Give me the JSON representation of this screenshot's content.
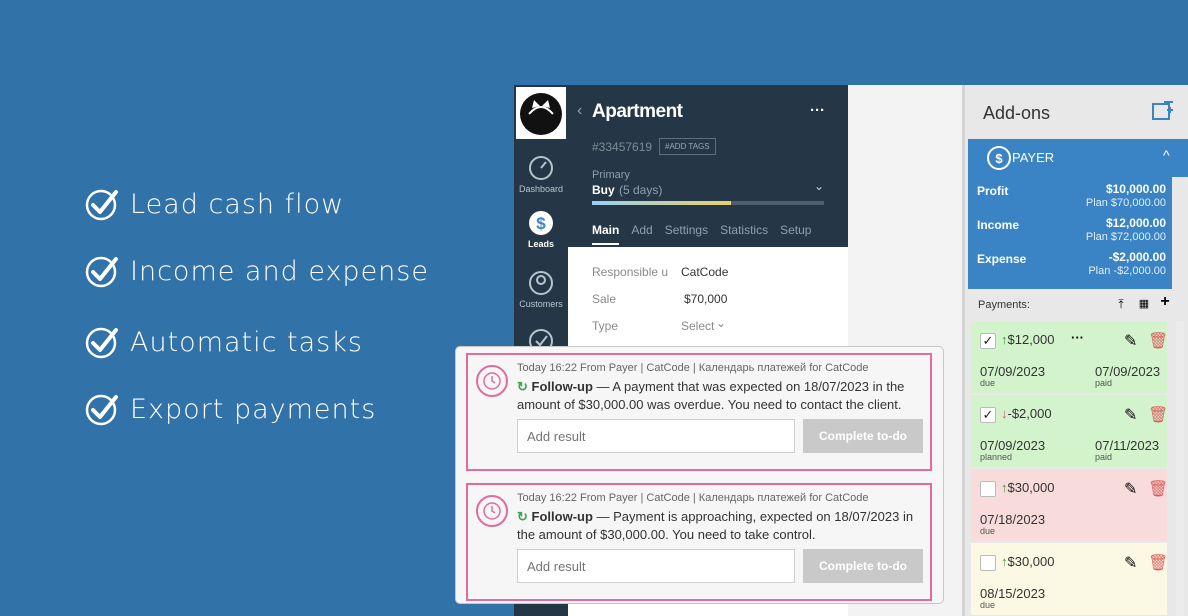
{
  "features": [
    {
      "label": "Lead cash flow"
    },
    {
      "label": "Income and expense"
    },
    {
      "label": "Automatic tasks"
    },
    {
      "label": "Export payments"
    }
  ],
  "nav": [
    {
      "label": "Dashboard",
      "icon": "dashboard-icon"
    },
    {
      "label": "Leads",
      "icon": "leads-icon"
    },
    {
      "label": "Customers",
      "icon": "customers-icon"
    },
    {
      "label": "",
      "icon": "tasks-icon"
    }
  ],
  "lead": {
    "title": "Apartment",
    "more": "···",
    "id": "#33457619",
    "add_tags": "#ADD TAGS",
    "pipeline": "Primary",
    "stage": "Buy",
    "stage_days": "(5 days)",
    "stage_progress": 0.6,
    "tabs": [
      "Main",
      "Add",
      "Settings",
      "Statistics",
      "Setup"
    ],
    "fields": [
      {
        "label": "Responsible u",
        "value": "CatCode"
      },
      {
        "label": "Sale",
        "value": "$70,000"
      },
      {
        "label": "Type",
        "value": "Select"
      }
    ]
  },
  "addons": {
    "title": "Add-ons",
    "payer_label": "PAYER",
    "summary": [
      {
        "key": "Profit",
        "value": "$10,000.00",
        "plan": "Plan $70,000.00"
      },
      {
        "key": "Income",
        "value": "$12,000.00",
        "plan": "Plan $72,000.00"
      },
      {
        "key": "Expense",
        "value": "-$2,000.00",
        "plan": "Plan -$2,000.00"
      }
    ],
    "payments_label": "Payments:",
    "payments": [
      {
        "checked": "✓",
        "amount": "$12,000",
        "dir": "up",
        "dots": "···",
        "date1": "07/09/2023",
        "s1": "due",
        "date2": "07/09/2023",
        "s2": "paid",
        "bg": "#d3f3cd"
      },
      {
        "checked": "✓",
        "amount": "-$2,000",
        "dir": "down",
        "dots": "",
        "date1": "07/09/2023",
        "s1": "planned",
        "date2": "07/11/2023",
        "s2": "paid",
        "bg": "#d3f3cd"
      },
      {
        "checked": "",
        "amount": "$30,000",
        "dir": "up",
        "dots": "",
        "date1": "07/18/2023",
        "s1": "due",
        "date2": "",
        "s2": "",
        "bg": "#f8dcdc"
      },
      {
        "checked": "",
        "amount": "$30,000",
        "dir": "up",
        "dots": "",
        "date1": "08/15/2023",
        "s1": "due",
        "date2": "",
        "s2": "",
        "bg": "#fbf9e4"
      }
    ]
  },
  "notes": [
    {
      "meta": "Today 16:22 From Payer | CatCode | Календарь платежей for CatCode",
      "kind": "Follow-up",
      "text": " — A payment that was expected on 18/07/2023 in the amount of $30,000.00 was overdue. You need to contact the client.",
      "placeholder": "Add result",
      "button": "Complete to-do"
    },
    {
      "meta": "Today 16:22 From Payer | CatCode | Календарь платежей for CatCode",
      "kind": "Follow-up",
      "text": " — Payment is approaching, expected on 18/07/2023 in the amount of $30,000.00. You need to take control.",
      "placeholder": "Add result",
      "button": "Complete to-do"
    }
  ],
  "colors": {
    "background": "#3172a9",
    "crm_dark": "#253746",
    "payer_blue": "#3a84c6",
    "note_border": "#e06c9f"
  }
}
